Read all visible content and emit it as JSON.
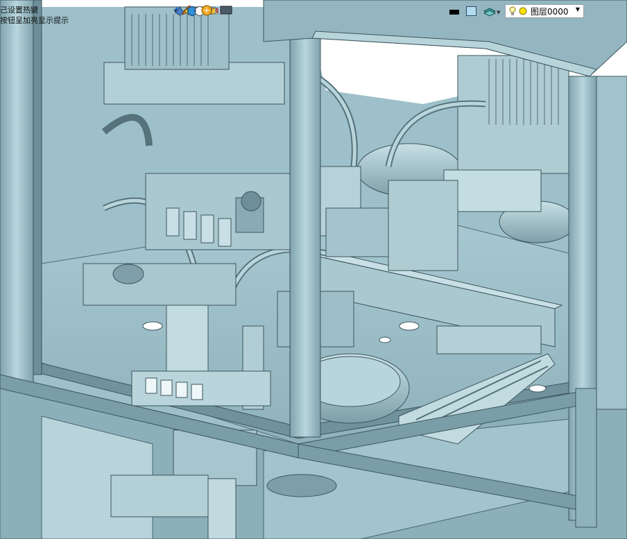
{
  "hints": {
    "line1": "己设置热键",
    "line2": "按钮呈加亮显示提示"
  },
  "toolbar": {
    "icons": [
      "undo-arrow-icon",
      "render-style-icon",
      "pencil-icon",
      "color-fill-icon",
      "solid-blue-box-icon",
      "wireframe-box-icon",
      "sun-light-icon",
      "lamp-icon",
      "red-point-icon",
      "edge-display-icon",
      "section-icon",
      "monitor-icon",
      "line-color-icon",
      "fill-color-icon",
      "layer-manager-icon"
    ],
    "layer_select": {
      "label": "图层0000",
      "lightbulb": "on",
      "color_dot": "#ffe000"
    }
  },
  "scene": {
    "background_color": "#ffffff",
    "model_color": "#9cc0ca",
    "model_dark": "#6a8c96",
    "frame_color": "#8fb3bd"
  }
}
